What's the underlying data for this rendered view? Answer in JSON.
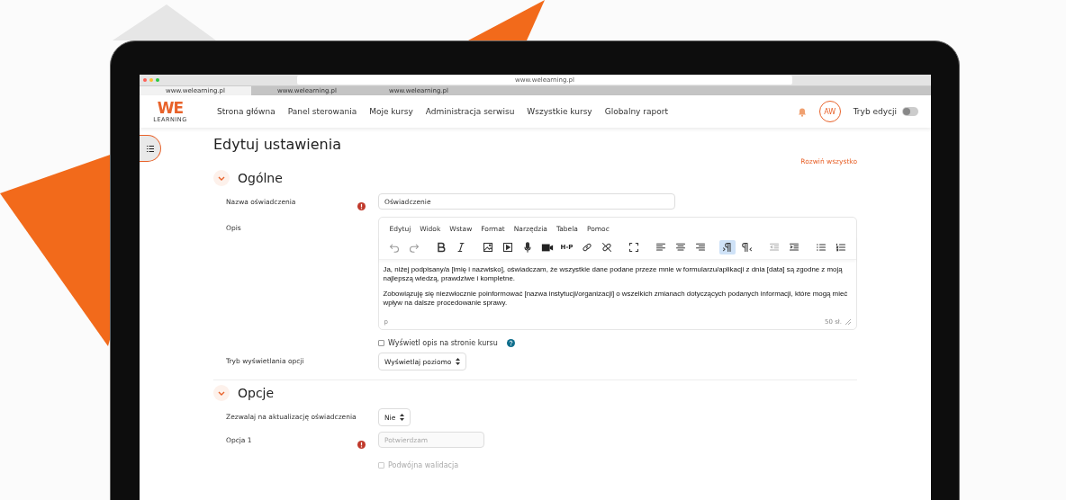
{
  "browser": {
    "url": "www.welearning.pl",
    "tabs": [
      {
        "title": "www.welearning.pl",
        "selected": true
      },
      {
        "title": "www.welearning.pl",
        "selected": false
      },
      {
        "title": "www.welearning.pl",
        "selected": false
      }
    ]
  },
  "navbar": {
    "logo": {
      "mark": "WE",
      "subtitle": "LEARNING"
    },
    "items": [
      {
        "label": "Strona główna"
      },
      {
        "label": "Panel sterowania"
      },
      {
        "label": "Moje kursy"
      },
      {
        "label": "Administracja serwisu"
      },
      {
        "label": "Wszystkie kursy"
      },
      {
        "label": "Globalny raport"
      }
    ],
    "avatar": "AW",
    "edit_mode": {
      "label": "Tryb edycji",
      "on": false
    }
  },
  "page": {
    "title": "Edytuj ustawienia",
    "expand_all": "Rozwiń wszystko"
  },
  "sections": [
    {
      "title": "Ogólne",
      "expanded": true,
      "fields": [
        {
          "kind": "text",
          "label": "Nazwa oświadczenia",
          "required": true,
          "value": "Oświadczenie"
        },
        {
          "kind": "editor",
          "label": "Opis",
          "menu": [
            "Edytuj",
            "Widok",
            "Wstaw",
            "Format",
            "Narzędzia",
            "Tabela",
            "Pomoc"
          ],
          "toolbar": [
            [
              {
                "kind": "undo",
                "selected": false
              },
              {
                "kind": "redo",
                "selected": false
              }
            ],
            [
              {
                "kind": "bold",
                "selected": false
              },
              {
                "kind": "italic",
                "selected": false
              }
            ],
            [
              {
                "kind": "image",
                "selected": false
              },
              {
                "kind": "media",
                "selected": false
              },
              {
                "kind": "mic",
                "selected": false
              },
              {
                "kind": "video",
                "selected": false
              },
              {
                "kind": "h5p",
                "label": "H-P",
                "selected": false
              },
              {
                "kind": "link",
                "selected": false
              },
              {
                "kind": "unlink",
                "selected": false
              }
            ],
            [
              {
                "kind": "fullscreen",
                "selected": false
              }
            ],
            [
              {
                "kind": "alignleft",
                "selected": false
              },
              {
                "kind": "aligncenter",
                "selected": false
              },
              {
                "kind": "alignright",
                "selected": false
              }
            ],
            [
              {
                "kind": "ltr",
                "selected": true
              },
              {
                "kind": "rtl",
                "selected": false
              }
            ],
            [
              {
                "kind": "outdent",
                "selected": false
              },
              {
                "kind": "indent",
                "selected": false
              }
            ],
            [
              {
                "kind": "bullets",
                "selected": false
              },
              {
                "kind": "numbers",
                "selected": false
              }
            ]
          ],
          "paragraphs": [
            "Ja, niżej podpisany/a [imię i nazwisko], oświadczam, że wszystkie dane podane przeze mnie w formularzu/aplikacji z dnia [data] są zgodne z moją najlepszą wiedzą, prawdziwe i kompletne.",
            "Zobowiązuję się niezwłocznie poinformować [nazwa instytucji/organizacji] o wszelkich zmianach dotyczących podanych informacji, które mogą mieć wpływ na dalsze procedowanie sprawy."
          ],
          "path": "p",
          "word_count": "50 sł."
        },
        {
          "kind": "checkbox",
          "label": "Wyświetl opis na stronie kursu",
          "checked": false,
          "disabled": false,
          "help": true
        },
        {
          "kind": "select",
          "label": "Tryb wyświetlania opcji",
          "value": "Wyświetlaj poziomo"
        }
      ]
    },
    {
      "title": "Opcje",
      "expanded": true,
      "fields": [
        {
          "kind": "select",
          "label": "Zezwalaj na aktualizację oświadczenia",
          "value": "Nie"
        },
        {
          "kind": "text",
          "label": "Opcja 1",
          "required": true,
          "placeholder": "Potwierdzam"
        },
        {
          "kind": "checkbox",
          "label": "Podwójna walidacja",
          "checked": false,
          "disabled": true,
          "help": false
        }
      ]
    }
  ]
}
